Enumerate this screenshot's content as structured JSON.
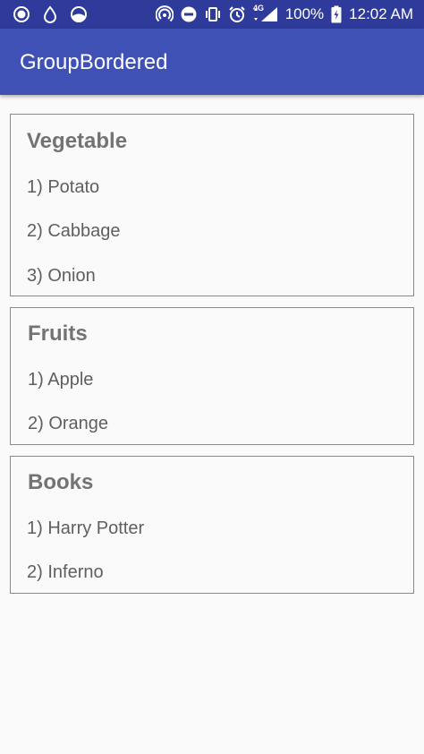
{
  "status_bar": {
    "left_icons": [
      "circle-record-icon",
      "water-drop-icon",
      "half-circle-icon"
    ],
    "right_icons": [
      "hotspot-icon",
      "do-not-disturb-icon",
      "vibrate-icon",
      "alarm-icon",
      "signal-4g-icon",
      "battery-charging-icon"
    ],
    "network": "4G",
    "battery": "100%",
    "time": "12:02 AM"
  },
  "app_bar": {
    "title": "GroupBordered"
  },
  "groups": [
    {
      "title": "Vegetable",
      "items": [
        "1) Potato",
        "2) Cabbage",
        "3) Onion"
      ]
    },
    {
      "title": "Fruits",
      "items": [
        "1) Apple",
        "2) Orange"
      ]
    },
    {
      "title": "Books",
      "items": [
        "1) Harry Potter",
        "2) Inferno"
      ]
    }
  ],
  "colors": {
    "status_bar": "#2f3b9b",
    "app_bar": "#3f51b5",
    "background": "#fafafa",
    "border": "#8a8a8a",
    "title_text": "#737373",
    "item_text": "#5f5f5f"
  }
}
